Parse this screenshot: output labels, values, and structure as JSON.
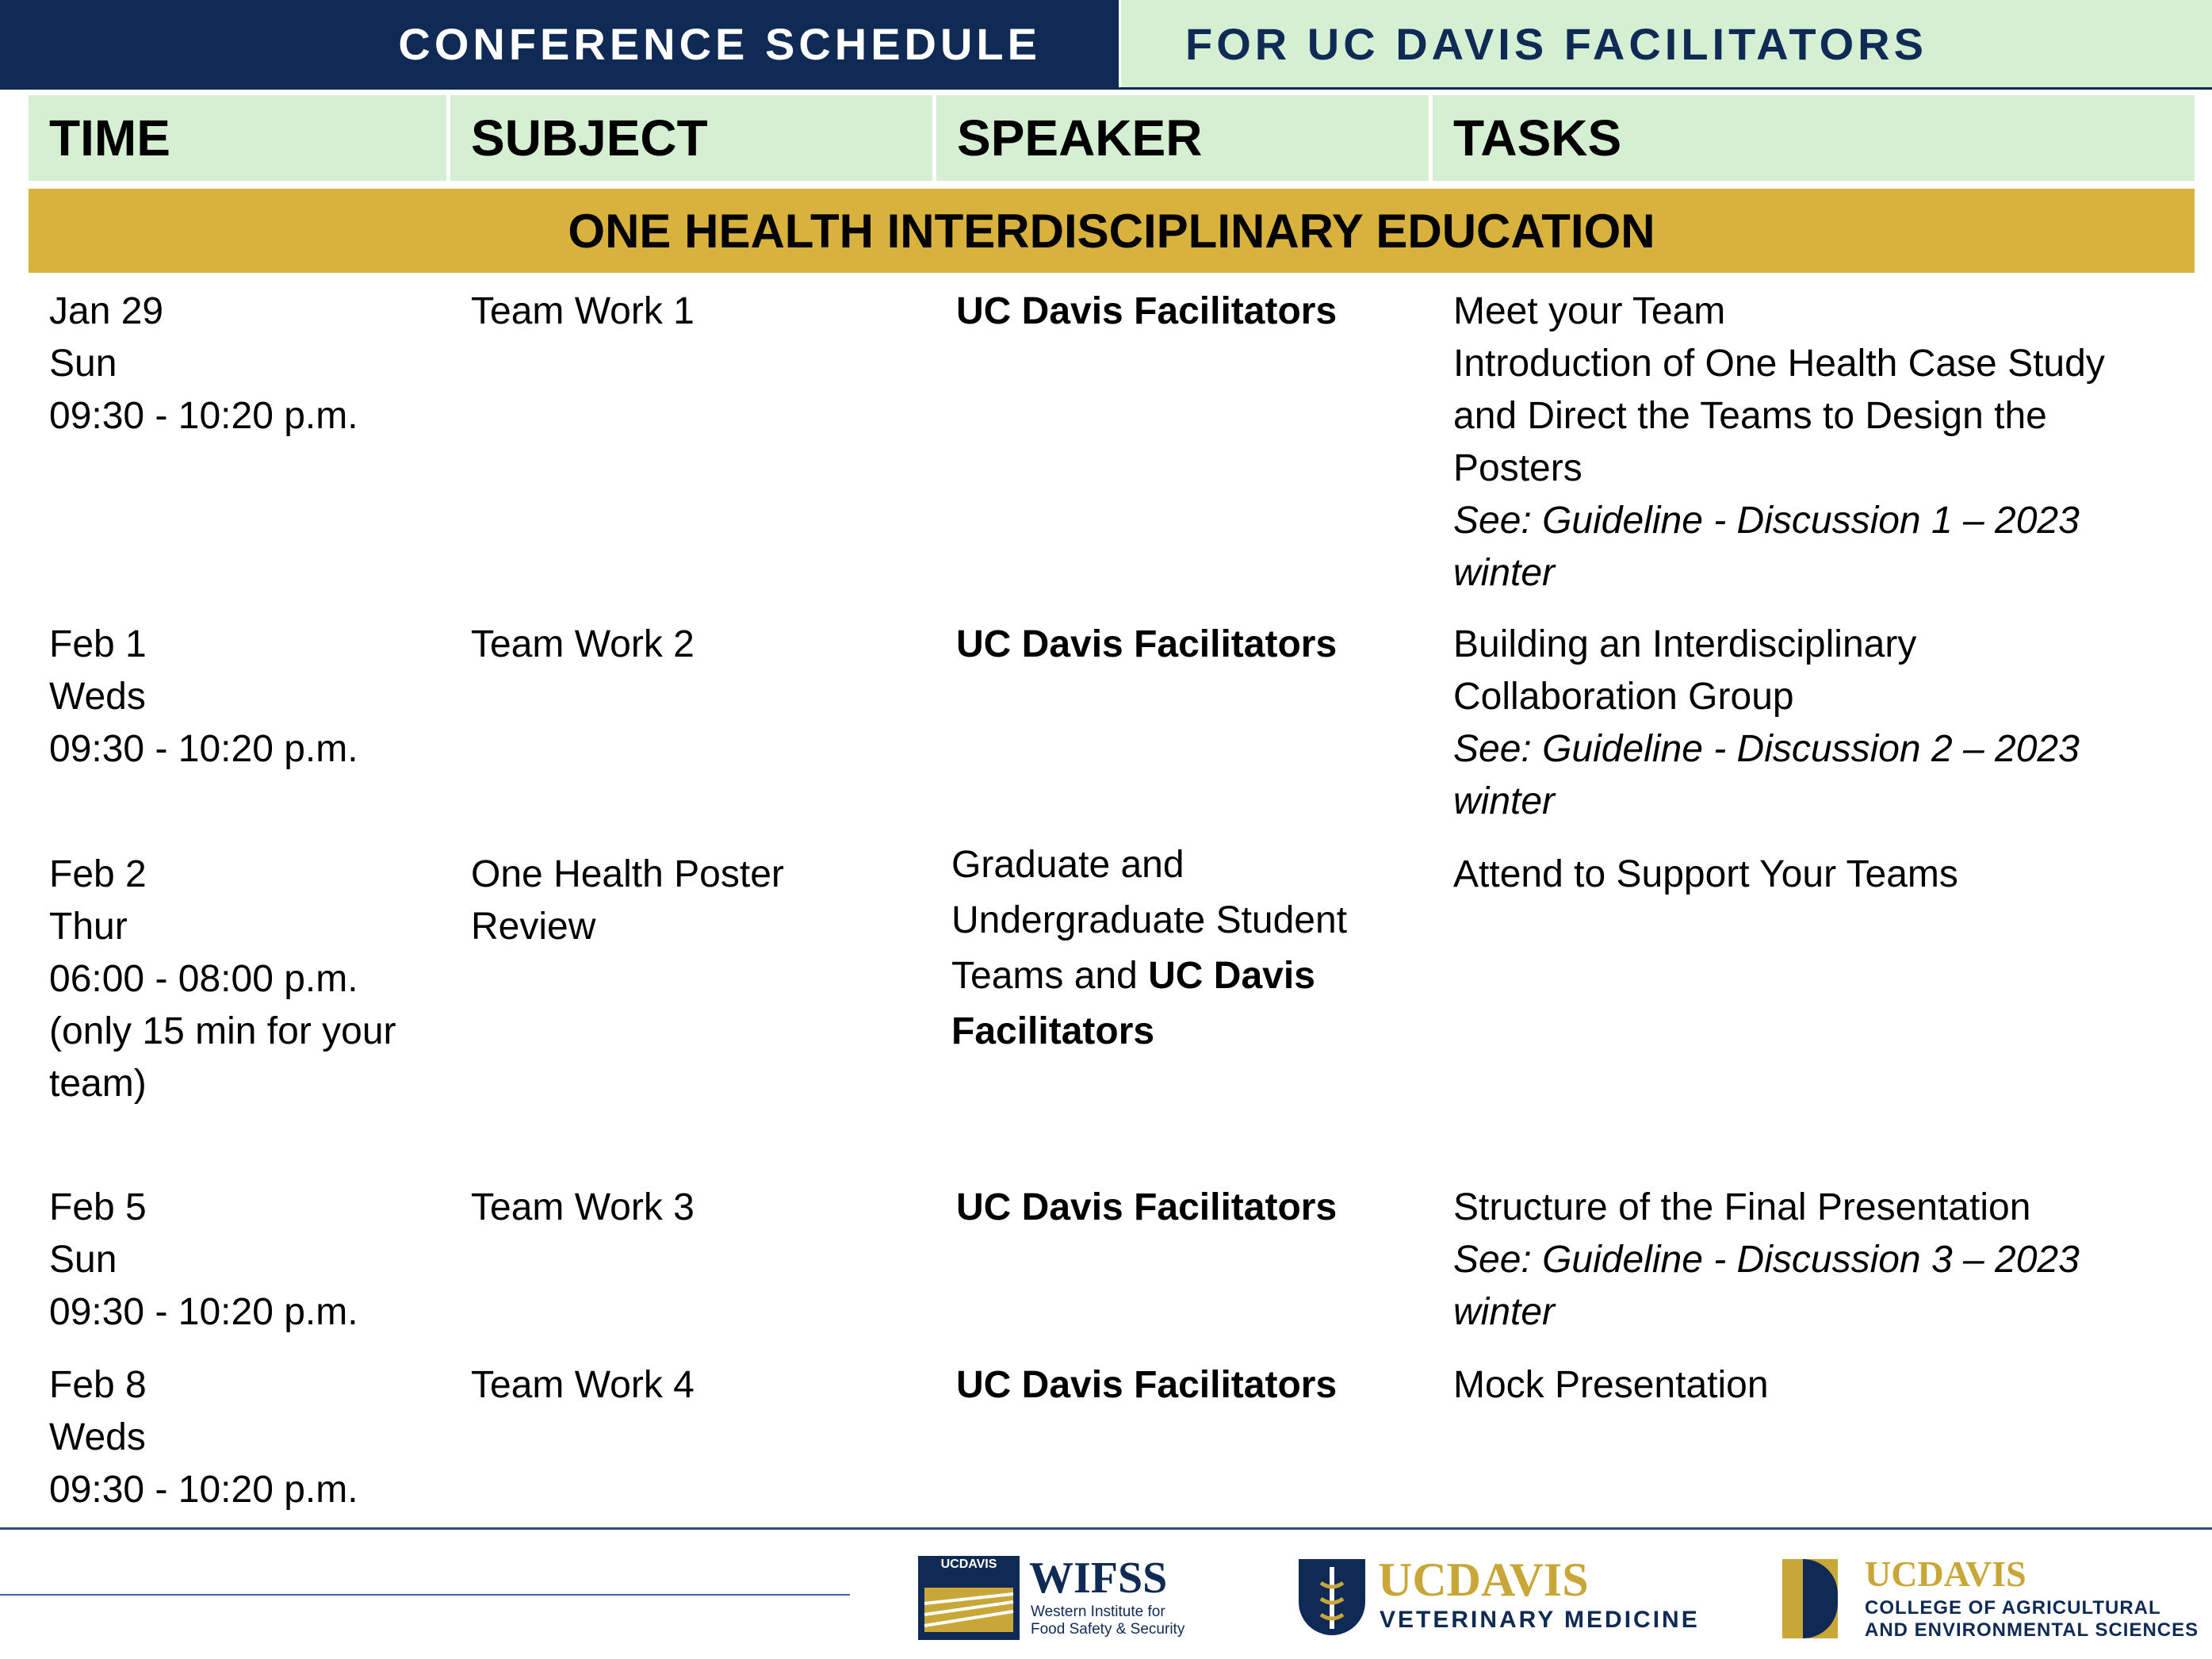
{
  "banner": {
    "left": "CONFERENCE SCHEDULE",
    "right": "FOR UC DAVIS FACILITATORS"
  },
  "headers": [
    "TIME",
    "SUBJECT",
    "SPEAKER",
    "TASKS"
  ],
  "section_title": "ONE HEALTH INTERDISCIPLINARY EDUCATION",
  "rows": [
    {
      "time": "Jan 29\nSun\n09:30 - 10:20 p.m.",
      "subject": "Team Work 1",
      "speaker_plain": "",
      "speaker_bold": "UC Davis Facilitators",
      "task": "Meet your Team\nIntroduction of One Health Case Study\nand Direct the Teams to Design the\nPosters",
      "guideline": "See: Guideline - Discussion 1 – 2023\nwinter"
    },
    {
      "time": "Feb 1\nWeds\n09:30 - 10:20 p.m.",
      "subject": "Team Work 2",
      "speaker_plain": "",
      "speaker_bold": "UC Davis Facilitators",
      "task": "Building an Interdisciplinary\nCollaboration Group",
      "guideline": "See: Guideline - Discussion 2 – 2023\nwinter"
    },
    {
      "time": "Feb 2\nThur\n06:00 - 08:00 p.m.\n(only 15 min for your\nteam)",
      "subject": "One Health Poster\nReview",
      "speaker_plain": "Graduate and\nUndergraduate Student\nTeams and ",
      "speaker_bold": "UC Davis\nFacilitators",
      "task": "Attend to Support Your Teams",
      "guideline": ""
    },
    {
      "time": "Feb 5\nSun\n09:30 - 10:20 p.m.",
      "subject": "Team Work 3",
      "speaker_plain": "",
      "speaker_bold": "UC Davis Facilitators",
      "task": "Structure of the Final Presentation",
      "guideline": "See: Guideline - Discussion 3 – 2023\nwinter"
    },
    {
      "time": "Feb 8\nWeds\n09:30 - 10:20 p.m.",
      "subject": "Team Work 4",
      "speaker_plain": "",
      "speaker_bold": "UC Davis Facilitators",
      "task": "Mock Presentation",
      "guideline": ""
    }
  ],
  "logos": {
    "wifss_tag": "UCDAVIS",
    "wifss_title": "WIFSS",
    "wifss_sub": "Western Institute for\nFood Safety & Security",
    "vet_ucd": "UCDAVIS",
    "vet_sub": "VETERINARY MEDICINE",
    "caes_ucd": "UCDAVIS",
    "caes_sub": "COLLEGE OF AGRICULTURAL\nAND ENVIRONMENTAL SCIENCES"
  },
  "colors": {
    "navy": "#0f2b55",
    "mint": "#d4efd2",
    "gold": "#d8b23c"
  }
}
